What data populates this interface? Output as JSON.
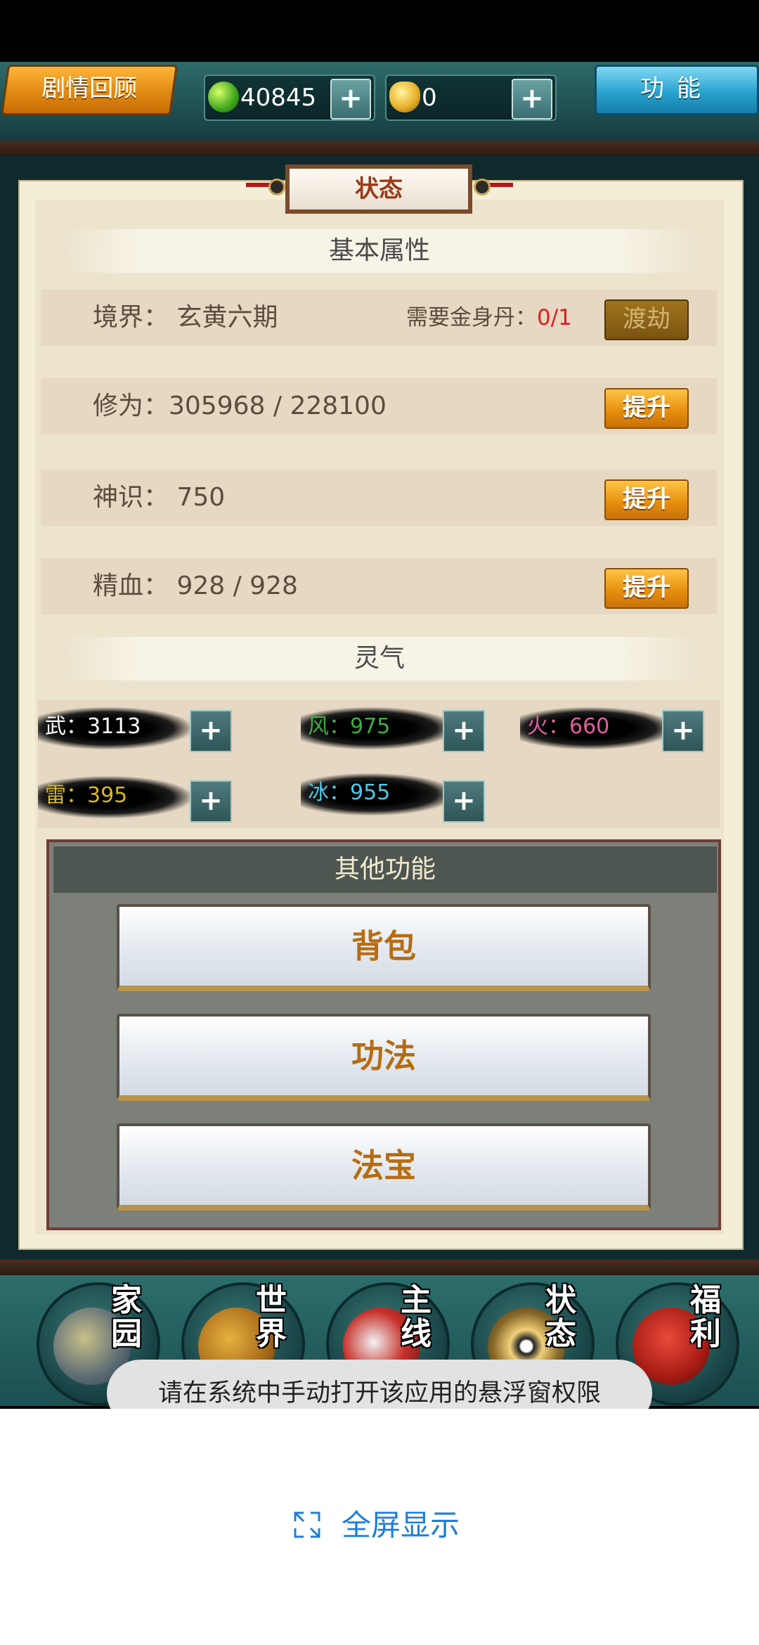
{
  "hud": {
    "story_label": "剧情回顾",
    "jade_amount": "40845",
    "gold_amount": "0",
    "plus": "+",
    "function_label": "功能"
  },
  "panel": {
    "title": "状态",
    "basic_header": "基本属性",
    "rows": [
      {
        "label": "境界：  玄黄六期",
        "need": "需要金身丹：",
        "need_value": "0/1",
        "button": "渡劫"
      },
      {
        "label": "修为：305968 / 228100",
        "button": "提升"
      },
      {
        "label": "神识：  750",
        "button": "提升"
      },
      {
        "label": "精血：  928  / 928",
        "button": "提升"
      }
    ],
    "ling_header": "灵气",
    "ling": [
      {
        "label": "武：",
        "value": "3113",
        "color": "#ffffff"
      },
      {
        "label": "风：",
        "value": "975",
        "color": "#3fae3f"
      },
      {
        "label": "火：",
        "value": "660",
        "color": "#e060a0"
      },
      {
        "label": "雷：",
        "value": "395",
        "color": "#d8b820"
      },
      {
        "label": "冰：",
        "value": "955",
        "color": "#4fc7e8"
      }
    ],
    "other_header": "其他功能",
    "other_buttons": [
      "背包",
      "功法",
      "法宝"
    ]
  },
  "nav": {
    "home": "家园",
    "world": "世界",
    "main": "主线",
    "status": "状态",
    "welfare": "福利"
  },
  "toast": "请在系统中手动打开该应用的悬浮窗权限",
  "fullscreen": {
    "label": "全屏显示",
    "icon": "expand-icon"
  }
}
